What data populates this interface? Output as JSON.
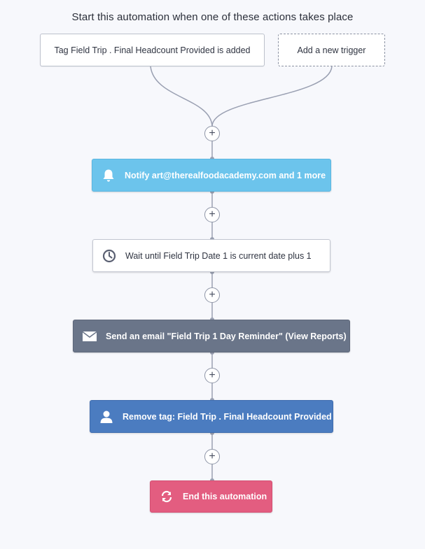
{
  "header": {
    "title": "Start this automation when one of these actions takes place"
  },
  "triggers": [
    {
      "label": "Tag Field Trip . Final Headcount Provided is added"
    },
    {
      "label": "Add a new trigger"
    }
  ],
  "steps": [
    {
      "label": "Notify art@therealfoodacademy.com and 1 more",
      "icon": "bell-icon",
      "color": "#6cc4ec"
    },
    {
      "label": "Wait until Field Trip Date 1 is current date plus 1",
      "icon": "clock-icon",
      "color": "#ffffff"
    },
    {
      "label": "Send an email \"Field Trip 1 Day Reminder\" (View Reports)",
      "icon": "envelope-icon",
      "color": "#6a7589"
    },
    {
      "label": "Remove tag: Field Trip . Final Headcount Provided",
      "icon": "user-icon",
      "color": "#4b7cc0"
    },
    {
      "label": "End this automation",
      "icon": "loop-arrows-icon",
      "color": "#e35d80"
    }
  ],
  "add_step_symbol": "+"
}
